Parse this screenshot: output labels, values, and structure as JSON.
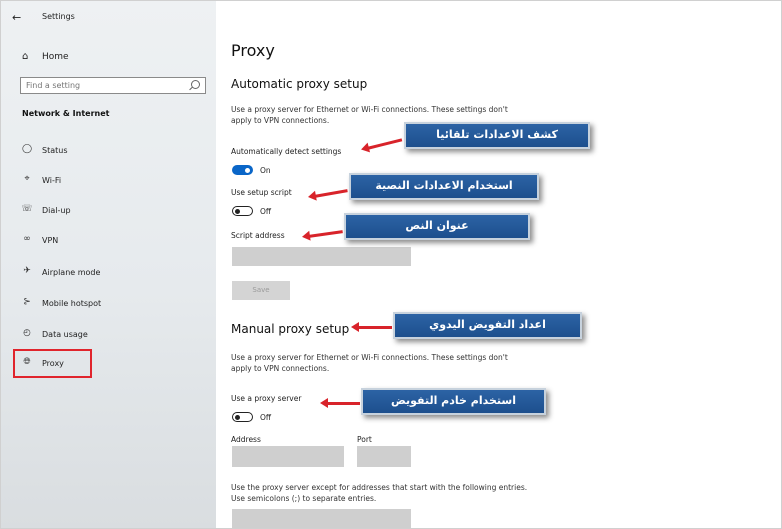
{
  "window": {
    "title": "Settings"
  },
  "sidebar": {
    "home_label": "Home",
    "search_placeholder": "Find a setting",
    "section_title": "Network & Internet",
    "items": [
      {
        "label": "Status",
        "icon": "status-icon"
      },
      {
        "label": "Wi-Fi",
        "icon": "wifi-icon"
      },
      {
        "label": "Dial-up",
        "icon": "dialup-icon"
      },
      {
        "label": "VPN",
        "icon": "vpn-icon"
      },
      {
        "label": "Airplane mode",
        "icon": "airplane-icon"
      },
      {
        "label": "Mobile hotspot",
        "icon": "hotspot-icon"
      },
      {
        "label": "Data usage",
        "icon": "data-usage-icon"
      },
      {
        "label": "Proxy",
        "icon": "globe-icon",
        "selected": true
      }
    ]
  },
  "main": {
    "title": "Proxy",
    "auto": {
      "heading": "Automatic proxy setup",
      "description": "Use a proxy server for Ethernet or Wi-Fi connections. These settings don't apply to VPN connections.",
      "detect_label": "Automatically detect settings",
      "detect_state": "On",
      "script_label": "Use setup script",
      "script_state": "Off",
      "address_label": "Script address",
      "save_label": "Save"
    },
    "manual": {
      "heading": "Manual proxy setup",
      "description": "Use a proxy server for Ethernet or Wi-Fi connections. These settings don't apply to VPN connections.",
      "use_proxy_label": "Use a proxy server",
      "use_proxy_state": "Off",
      "address_label": "Address",
      "port_label": "Port",
      "exceptions_text": "Use the proxy server except for addresses that start with the following entries. Use semicolons (;) to separate entries."
    }
  },
  "annotations": {
    "detect": "كشف الاعدادات تلقائيا",
    "script": "استخدام الاعدادات النصية",
    "address": "عنوان النص",
    "manual": "اعداد التفويض اليدوي",
    "use_proxy": "استخدام خادم التفويض"
  },
  "colors": {
    "accent": "#0a66c8",
    "callout": "#2c63a5",
    "arrow": "#d8232a",
    "highlight": "#e0242c"
  }
}
